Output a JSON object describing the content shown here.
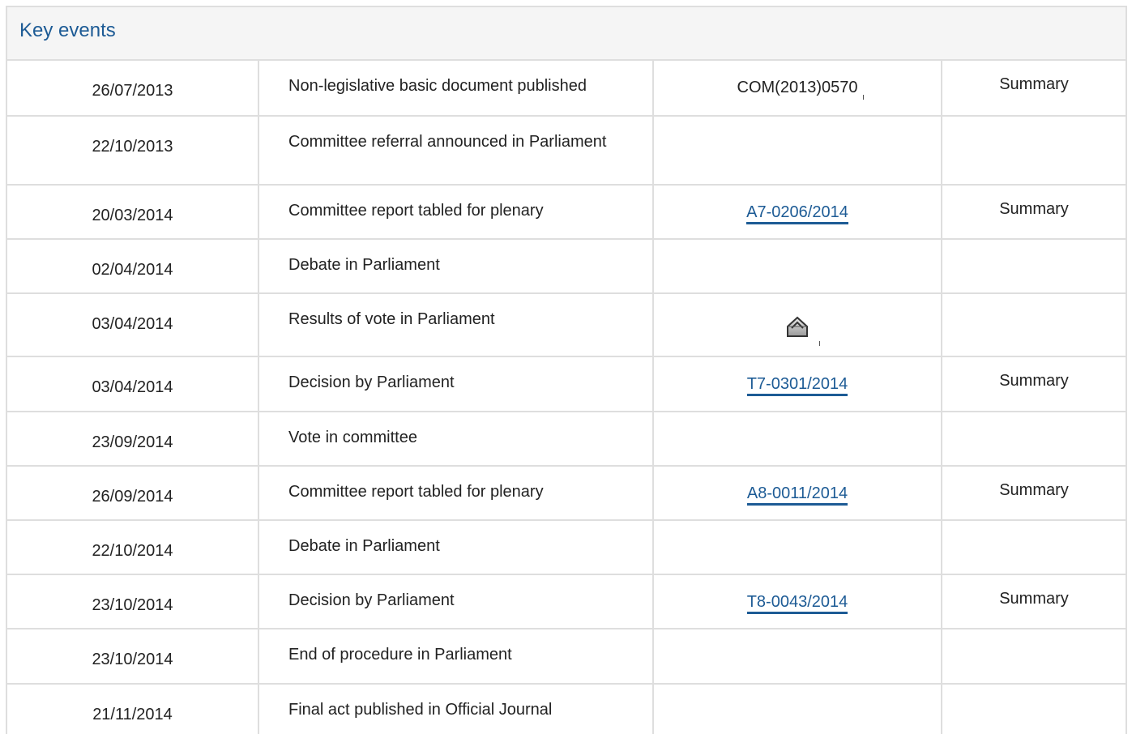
{
  "panel": {
    "title": "Key events"
  },
  "rows": [
    {
      "date": "26/07/2013",
      "event": "Non-legislative basic document published",
      "doc": "COM(2013)0570",
      "doc_link": false,
      "summary": "Summary"
    },
    {
      "date": "22/10/2013",
      "event": "Committee referral announced in Parliament",
      "doc": "",
      "doc_link": false,
      "summary": ""
    },
    {
      "date": "20/03/2014",
      "event": "Committee report tabled for plenary",
      "doc": "A7-0206/2014",
      "doc_link": true,
      "summary": "Summary"
    },
    {
      "date": "02/04/2014",
      "event": "Debate in Parliament",
      "doc": "",
      "doc_link": false,
      "summary": ""
    },
    {
      "date": "03/04/2014",
      "event": "Results of vote in Parliament",
      "doc": "",
      "doc_icon": "ballot-box-icon",
      "doc_link": false,
      "summary": ""
    },
    {
      "date": "03/04/2014",
      "event": "Decision by Parliament",
      "doc": "T7-0301/2014",
      "doc_link": true,
      "summary": "Summary"
    },
    {
      "date": "23/09/2014",
      "event": "Vote in committee",
      "doc": "",
      "doc_link": false,
      "summary": ""
    },
    {
      "date": "26/09/2014",
      "event": "Committee report tabled for plenary",
      "doc": "A8-0011/2014",
      "doc_link": true,
      "summary": "Summary"
    },
    {
      "date": "22/10/2014",
      "event": "Debate in Parliament",
      "doc": "",
      "doc_link": false,
      "summary": ""
    },
    {
      "date": "23/10/2014",
      "event": "Decision by Parliament",
      "doc": "T8-0043/2014",
      "doc_link": true,
      "summary": "Summary"
    },
    {
      "date": "23/10/2014",
      "event": "End of procedure in Parliament",
      "doc": "",
      "doc_link": false,
      "summary": ""
    },
    {
      "date": "21/11/2014",
      "event": "Final act published in Official Journal",
      "doc": "",
      "doc_link": false,
      "summary": ""
    }
  ],
  "colors": {
    "link": "#1d5b95",
    "border": "#dedede",
    "header_bg": "#f5f5f5"
  }
}
